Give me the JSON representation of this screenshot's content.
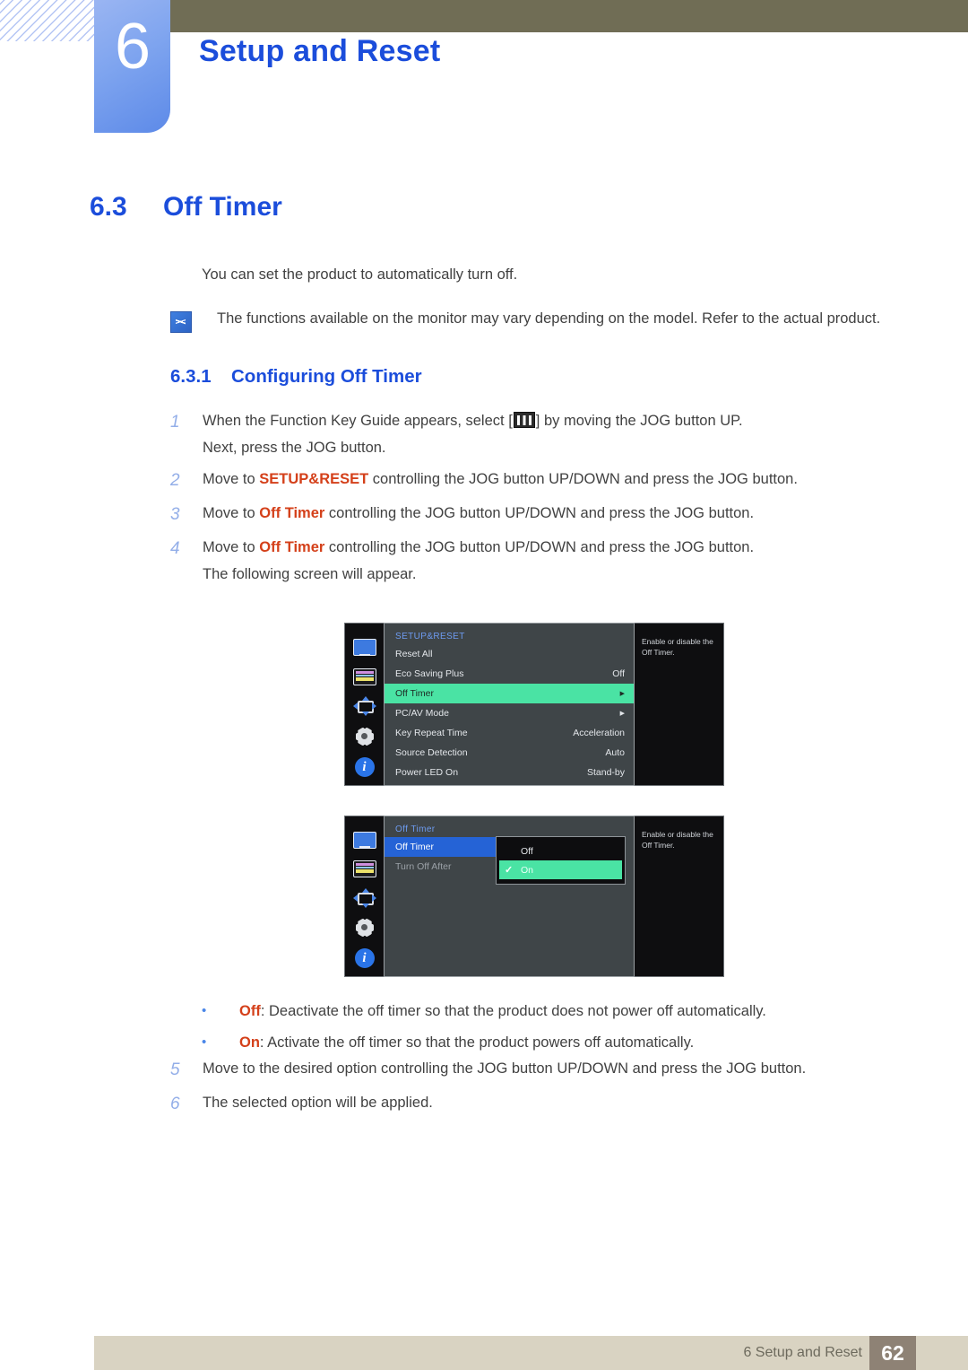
{
  "header": {
    "chapter_number": "6",
    "chapter_title": "Setup and Reset"
  },
  "section": {
    "number": "6.3",
    "title": "Off Timer",
    "intro": "You can set the product to automatically turn off.",
    "note": "The functions available on the monitor may vary depending on the model. Refer to the actual product."
  },
  "subsection": {
    "number": "6.3.1",
    "title": "Configuring Off Timer"
  },
  "steps": [
    {
      "num": "1",
      "pre": "When the Function Key Guide appears, select [",
      "post": "] by moving the JOG button UP.",
      "sub": "Next, press the JOG button.",
      "icon": "menu-bars-icon"
    },
    {
      "num": "2",
      "pre": "Move to ",
      "keyword": "SETUP&RESET",
      "post": " controlling the JOG button UP/DOWN and press the JOG button."
    },
    {
      "num": "3",
      "pre": "Move to ",
      "keyword": "Off Timer",
      "post": " controlling the JOG button UP/DOWN and press the JOG button."
    },
    {
      "num": "4",
      "pre": "Move to ",
      "keyword": "Off Timer",
      "post": " controlling the JOG button UP/DOWN and press the JOG button.",
      "sub": "The following screen will appear."
    }
  ],
  "steps_after": [
    {
      "num": "5",
      "text": "Move to the desired option controlling the JOG button UP/DOWN and press the JOG button."
    },
    {
      "num": "6",
      "text": "The selected option will be applied."
    }
  ],
  "bullets": [
    {
      "marker": "•",
      "keyword": "Off",
      "text": ": Deactivate the off timer so that the product does not power off automatically."
    },
    {
      "marker": "•",
      "keyword": "On",
      "text": ": Activate the off timer so that the product powers off automatically."
    }
  ],
  "osd_1": {
    "title": "SETUP&RESET",
    "help": "Enable or disable the Off Timer.",
    "rail_icons": [
      "monitor-icon",
      "picture-icon",
      "navigation-icon",
      "gear-icon",
      "info-icon"
    ],
    "rows": [
      {
        "label": "Reset All",
        "value": ""
      },
      {
        "label": "Eco Saving Plus",
        "value": "Off"
      },
      {
        "label": "Off Timer",
        "value": "▶",
        "highlight": "green"
      },
      {
        "label": "PC/AV Mode",
        "value": "▶"
      },
      {
        "label": "Key Repeat Time",
        "value": "Acceleration"
      },
      {
        "label": "Source Detection",
        "value": "Auto"
      },
      {
        "label": "Power LED On",
        "value": "Stand-by"
      }
    ]
  },
  "osd_2": {
    "title": "Off Timer",
    "help": "Enable or disable the Off Timer.",
    "rail_icons": [
      "monitor-icon",
      "picture-icon",
      "navigation-icon",
      "gear-icon",
      "info-icon"
    ],
    "rows": [
      {
        "label": "Off Timer",
        "highlight": "blue"
      },
      {
        "label": "Turn Off After",
        "highlight": "dim"
      }
    ],
    "popup": {
      "options": [
        {
          "label": "Off",
          "checked": false
        },
        {
          "label": "On",
          "checked": true,
          "check_glyph": "✓"
        }
      ]
    }
  },
  "footer": {
    "text": "6 Setup and Reset",
    "page": "62"
  },
  "colors": {
    "heading_blue": "#1b4ddb",
    "keyword_red": "#d4401a",
    "osd_green": "#4ae3a4",
    "osd_blue": "#2563d6",
    "top_bar": "#706d55",
    "footer_bar": "#d9d3c2",
    "footer_page_box": "#8e8275"
  }
}
